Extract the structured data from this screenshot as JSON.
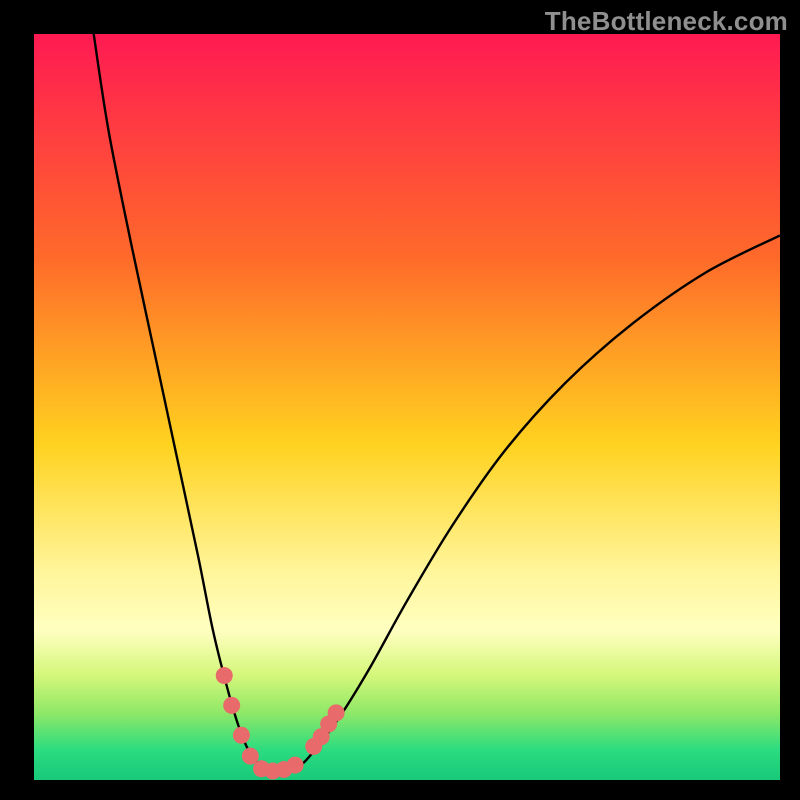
{
  "watermark": "TheBottleneck.com",
  "chart_data": {
    "type": "line",
    "title": "",
    "xlabel": "",
    "ylabel": "",
    "xlim": [
      0,
      100
    ],
    "ylim": [
      0,
      100
    ],
    "background_gradient": {
      "stops": [
        {
          "offset": 0.0,
          "color": "#ff1a52"
        },
        {
          "offset": 0.3,
          "color": "#ff6a2a"
        },
        {
          "offset": 0.55,
          "color": "#ffd21f"
        },
        {
          "offset": 0.72,
          "color": "#fff59a"
        },
        {
          "offset": 0.8,
          "color": "#ffffc0"
        },
        {
          "offset": 0.86,
          "color": "#d4f77a"
        },
        {
          "offset": 0.91,
          "color": "#8fe867"
        },
        {
          "offset": 0.96,
          "color": "#2bdc80"
        },
        {
          "offset": 1.0,
          "color": "#18c97a"
        }
      ]
    },
    "series": [
      {
        "name": "curve",
        "x": [
          8,
          10,
          13,
          16,
          19,
          22,
          24,
          26,
          27.5,
          29,
          30.5,
          32,
          34,
          36,
          38,
          41,
          45,
          50,
          56,
          63,
          71,
          80,
          90,
          100
        ],
        "y": [
          100,
          87,
          72,
          58,
          44,
          30,
          20,
          12,
          7,
          3.5,
          1.8,
          1.2,
          1.3,
          2.2,
          4.5,
          8.5,
          15,
          24,
          34,
          44,
          53,
          61,
          68,
          73
        ]
      }
    ],
    "markers": {
      "name": "highlight-dots",
      "color": "#e86a6a",
      "points": [
        {
          "x": 25.5,
          "y": 14
        },
        {
          "x": 26.5,
          "y": 10
        },
        {
          "x": 27.8,
          "y": 6
        },
        {
          "x": 29.0,
          "y": 3.2
        },
        {
          "x": 30.5,
          "y": 1.5
        },
        {
          "x": 32.0,
          "y": 1.2
        },
        {
          "x": 33.5,
          "y": 1.4
        },
        {
          "x": 35.0,
          "y": 2.0
        },
        {
          "x": 37.5,
          "y": 4.5
        },
        {
          "x": 38.5,
          "y": 5.8
        },
        {
          "x": 39.5,
          "y": 7.5
        },
        {
          "x": 40.5,
          "y": 9.0
        }
      ]
    }
  }
}
